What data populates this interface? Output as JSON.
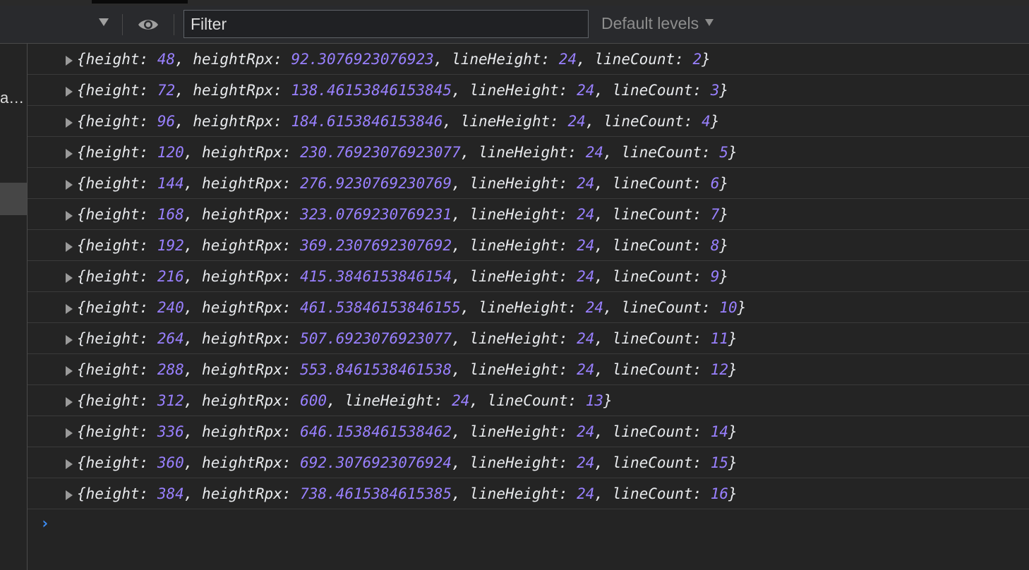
{
  "toolbar": {
    "filter_placeholder": "Filter",
    "filter_value": "",
    "levels_label": "Default levels"
  },
  "sidebar": {
    "truncated_label": "a…"
  },
  "console": {
    "prompt_symbol": "›",
    "entries": [
      {
        "height": "48",
        "heightRpx": "92.3076923076923",
        "lineHeight": "24",
        "lineCount": "2"
      },
      {
        "height": "72",
        "heightRpx": "138.46153846153845",
        "lineHeight": "24",
        "lineCount": "3"
      },
      {
        "height": "96",
        "heightRpx": "184.6153846153846",
        "lineHeight": "24",
        "lineCount": "4"
      },
      {
        "height": "120",
        "heightRpx": "230.76923076923077",
        "lineHeight": "24",
        "lineCount": "5"
      },
      {
        "height": "144",
        "heightRpx": "276.9230769230769",
        "lineHeight": "24",
        "lineCount": "6"
      },
      {
        "height": "168",
        "heightRpx": "323.0769230769231",
        "lineHeight": "24",
        "lineCount": "7"
      },
      {
        "height": "192",
        "heightRpx": "369.2307692307692",
        "lineHeight": "24",
        "lineCount": "8"
      },
      {
        "height": "216",
        "heightRpx": "415.3846153846154",
        "lineHeight": "24",
        "lineCount": "9"
      },
      {
        "height": "240",
        "heightRpx": "461.53846153846155",
        "lineHeight": "24",
        "lineCount": "10"
      },
      {
        "height": "264",
        "heightRpx": "507.6923076923077",
        "lineHeight": "24",
        "lineCount": "11"
      },
      {
        "height": "288",
        "heightRpx": "553.8461538461538",
        "lineHeight": "24",
        "lineCount": "12"
      },
      {
        "height": "312",
        "heightRpx": "600",
        "lineHeight": "24",
        "lineCount": "13"
      },
      {
        "height": "336",
        "heightRpx": "646.1538461538462",
        "lineHeight": "24",
        "lineCount": "14"
      },
      {
        "height": "360",
        "heightRpx": "692.3076923076924",
        "lineHeight": "24",
        "lineCount": "15"
      },
      {
        "height": "384",
        "heightRpx": "738.4615384615385",
        "lineHeight": "24",
        "lineCount": "16"
      }
    ]
  },
  "colors": {
    "background": "#242424",
    "number": "#9980ff",
    "text": "#e8eaed",
    "prompt": "#3d8ef7"
  }
}
